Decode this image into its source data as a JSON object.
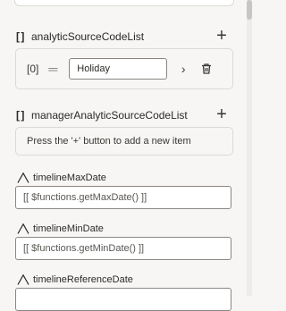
{
  "analytic_section": {
    "title": "analyticSourceCodeList",
    "add_button": "+",
    "items": [
      {
        "index": "[0]",
        "value": "Holiday"
      }
    ]
  },
  "manager_section": {
    "title": "managerAnalyticSourceCodeList",
    "add_button": "+",
    "empty_hint": "Press the '+' button to add a new item"
  },
  "fields": [
    {
      "label": "timelineMaxDate",
      "value": "[[ $functions.getMaxDate() ]]"
    },
    {
      "label": "timelineMinDate",
      "value": "[[ $functions.getMinDate() ]]"
    },
    {
      "label": "timelineReferenceDate",
      "value": ""
    }
  ],
  "icons": {
    "array": "brackets-icon",
    "string": "text-type-icon",
    "navigate": "chevron-right-icon",
    "delete": "trash-icon"
  }
}
